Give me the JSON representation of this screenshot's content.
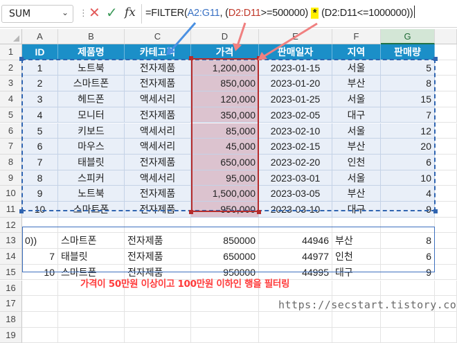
{
  "formula_bar": {
    "name_box": "SUM",
    "fx_label": "fx",
    "formula_parts": [
      "=FILTER(",
      "A2:G11",
      ", (",
      "D2:D11",
      ">=500000)",
      "*",
      "(D2:D11<=1000000)",
      ")"
    ]
  },
  "columns": [
    "A",
    "B",
    "C",
    "D",
    "E",
    "F",
    "G"
  ],
  "rows": [
    "1",
    "2",
    "3",
    "4",
    "5",
    "6",
    "7",
    "8",
    "9",
    "10",
    "11",
    "12",
    "13",
    "14",
    "15",
    "16",
    "17",
    "18",
    "19"
  ],
  "table": {
    "headers": [
      "ID",
      "제품명",
      "카테고리",
      "가격",
      "판매일자",
      "지역",
      "판매량"
    ],
    "rows": [
      [
        "1",
        "노트북",
        "전자제품",
        "1,200,000",
        "2023-01-15",
        "서울",
        "5"
      ],
      [
        "2",
        "스마트폰",
        "전자제품",
        "850,000",
        "2023-01-20",
        "부산",
        "8"
      ],
      [
        "3",
        "헤드폰",
        "액세서리",
        "120,000",
        "2023-01-25",
        "서울",
        "15"
      ],
      [
        "4",
        "모니터",
        "전자제품",
        "350,000",
        "2023-02-05",
        "대구",
        "7"
      ],
      [
        "5",
        "키보드",
        "액세서리",
        "85,000",
        "2023-02-10",
        "서울",
        "12"
      ],
      [
        "6",
        "마우스",
        "액세서리",
        "45,000",
        "2023-02-15",
        "부산",
        "20"
      ],
      [
        "7",
        "태블릿",
        "전자제품",
        "650,000",
        "2023-02-20",
        "인천",
        "6"
      ],
      [
        "8",
        "스피커",
        "액세서리",
        "95,000",
        "2023-03-01",
        "서울",
        "10"
      ],
      [
        "9",
        "노트북",
        "전자제품",
        "1,500,000",
        "2023-03-05",
        "부산",
        "4"
      ],
      [
        "10",
        "스마트폰",
        "전자제품",
        "950,000",
        "2023-03-10",
        "대구",
        "9"
      ]
    ]
  },
  "result": {
    "rows": [
      [
        "0))",
        "스마트폰",
        "전자제품",
        "850000",
        "44946",
        "부산",
        "8"
      ],
      [
        "7",
        "태블릿",
        "전자제품",
        "650000",
        "44977",
        "인천",
        "6"
      ],
      [
        "10",
        "스마트폰",
        "전자제품",
        "950000",
        "44995",
        "대구",
        "9"
      ]
    ]
  },
  "annotation": "가격이 50만원 이상이고 100만원 이하인 행을 필터링",
  "watermark": "https://secstart.tistory.com",
  "colors": {
    "header_bg": "#1b8fc8",
    "body_bg": "#e9eff8",
    "price_highlight": "#dcc3cf",
    "star_highlight": "#ffef00",
    "blue_arrow": "#4a90e2",
    "red_arrow": "#f08080"
  }
}
